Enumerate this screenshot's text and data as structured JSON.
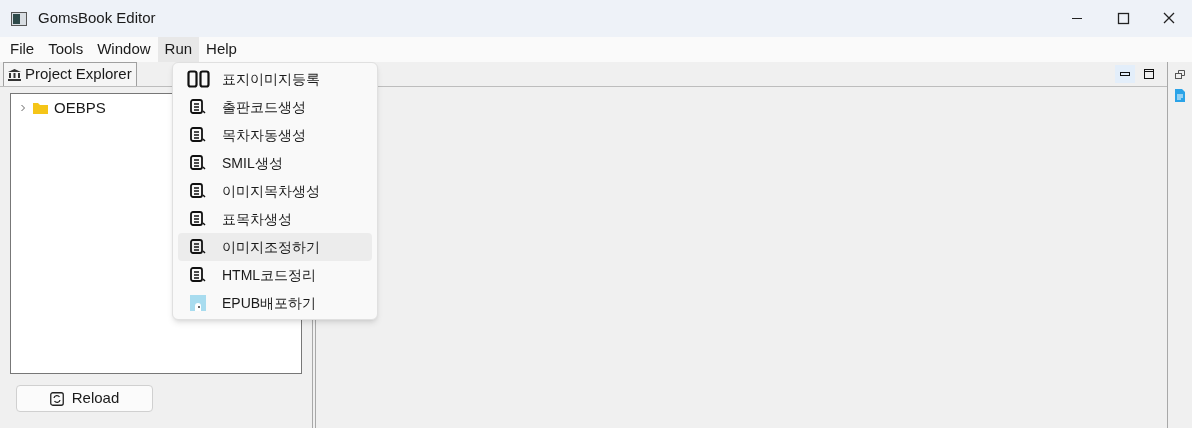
{
  "window": {
    "title": "GomsBook Editor"
  },
  "menu_bar": [
    {
      "label": "File",
      "selected": false
    },
    {
      "label": "Tools",
      "selected": false
    },
    {
      "label": "Window",
      "selected": false
    },
    {
      "label": "Run",
      "selected": true
    },
    {
      "label": "Help",
      "selected": false
    }
  ],
  "run_menu": [
    {
      "label": "표지이미지등록",
      "kind": "book",
      "selected": false
    },
    {
      "label": "출판코드생성",
      "kind": "doc",
      "selected": false
    },
    {
      "label": "목차자동생성",
      "kind": "doc",
      "selected": false
    },
    {
      "label": "SMIL생성",
      "kind": "doc",
      "selected": false
    },
    {
      "label": "이미지목차생성",
      "kind": "doc",
      "selected": false
    },
    {
      "label": "표목차생성",
      "kind": "doc",
      "selected": false
    },
    {
      "label": "이미지조정하기",
      "kind": "doc",
      "selected": true
    },
    {
      "label": "HTML코드정리",
      "kind": "doc",
      "selected": false
    },
    {
      "label": "EPUB배포하기",
      "kind": "image",
      "selected": false
    }
  ],
  "project_explorer": {
    "tab": "Project Explorer",
    "tree": [
      {
        "label": "OEBPS",
        "expanded": false
      }
    ],
    "reload_button": "Reload"
  }
}
